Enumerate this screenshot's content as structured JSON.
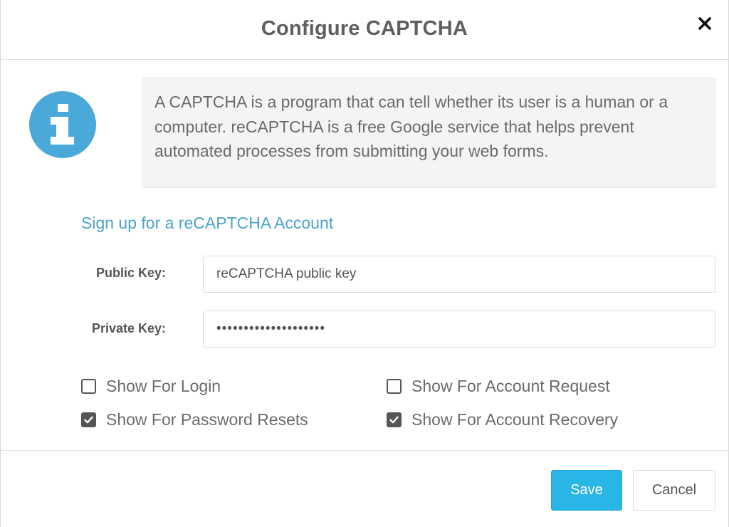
{
  "dialog": {
    "title": "Configure CAPTCHA",
    "close_icon": "close-icon"
  },
  "info": {
    "icon": "info-icon",
    "icon_color": "#4aa9d8",
    "text": "A CAPTCHA is a program that can tell whether its user is a human or a computer. reCAPTCHA is a free Google service that helps prevent automated processes from submitting your web forms."
  },
  "signup_link": "Sign up for a reCAPTCHA Account",
  "form": {
    "public_key_label": "Public Key:",
    "public_key_value": "reCAPTCHA public key",
    "private_key_label": "Private Key:",
    "private_key_value": "••••••••••••••••••••"
  },
  "options": [
    {
      "label": "Show For Login",
      "checked": false
    },
    {
      "label": "Show For Account Request",
      "checked": false
    },
    {
      "label": "Show For Password Resets",
      "checked": true
    },
    {
      "label": "Show For Account Recovery",
      "checked": true
    }
  ],
  "buttons": {
    "save": "Save",
    "cancel": "Cancel",
    "save_color": "#29b5e6"
  }
}
